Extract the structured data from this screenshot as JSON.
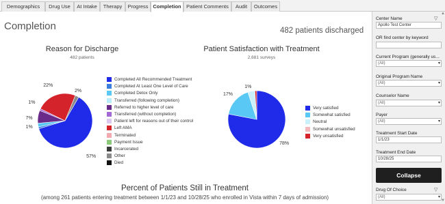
{
  "tabs": [
    {
      "label": "Demographics",
      "active": false
    },
    {
      "label": "Drug Use",
      "active": false
    },
    {
      "label": "At Intake",
      "active": false
    },
    {
      "label": "Therapy",
      "active": false
    },
    {
      "label": "Progress",
      "active": false
    },
    {
      "label": "Completion",
      "active": true
    },
    {
      "label": "Patient Comments",
      "active": false
    },
    {
      "label": "Audit",
      "active": false
    },
    {
      "label": "Outcomes",
      "active": false
    }
  ],
  "page": {
    "title": "Completion",
    "discharged": "482 patients discharged"
  },
  "chart_data": [
    {
      "type": "pie",
      "title": "Reason for Discharge",
      "subtitle": "482 patients",
      "labels": [
        "Completed All Recommended Treatment",
        "Completed At Least One Level of Care",
        "Completed Detox Only",
        "Transferred (following completion)",
        "Referred to higher level of care",
        "Transferred (without completion)",
        "Patient left for reasons out of their control",
        "Left AMA",
        "Terminated",
        "Payment Issue",
        "Incarcerated",
        "Other",
        "Died"
      ],
      "colors": [
        "#1f2be8",
        "#3a7fe0",
        "#5ac8f5",
        "#b8ecfb",
        "#6a2a8a",
        "#a36ad6",
        "#dcc7ef",
        "#d4232a",
        "#f4a8b0",
        "#8ac97a",
        "#3a3a3a",
        "#8a8a8a",
        "#111111"
      ],
      "values": [
        57,
        1,
        2,
        0,
        7,
        1,
        0,
        22,
        0,
        0,
        0,
        2,
        0
      ],
      "data_labels": [
        {
          "index": 0,
          "text": "57%"
        },
        {
          "index": 2,
          "text": "1%"
        },
        {
          "index": 4,
          "text": "7%"
        },
        {
          "index": 5,
          "text": "1%"
        },
        {
          "index": 7,
          "text": "22%"
        },
        {
          "index": 11,
          "text": "2%"
        }
      ]
    },
    {
      "type": "pie",
      "title": "Patient Satisfaction with Treatment",
      "subtitle": "2,681 surveys",
      "labels": [
        "Very satisfied",
        "Somewhat satisfied",
        "Neutral",
        "Somewhat unsatisfied",
        "Very unsatisfied"
      ],
      "colors": [
        "#1f2be8",
        "#5ac8f5",
        "#c9f0fb",
        "#f4b8bc",
        "#d4232a"
      ],
      "values": [
        78,
        17,
        4,
        0,
        1
      ],
      "data_labels": [
        {
          "index": 0,
          "text": "78%"
        },
        {
          "index": 1,
          "text": "17%"
        },
        {
          "index": 2,
          "text": "1%"
        }
      ]
    }
  ],
  "bottom": {
    "title": "Percent of Patients Still in Treatment",
    "subtitle": "(among 261 patients entering treatment between 1/1/23 and 10/28/25 who enrolled in Vista within 7 days of admission)"
  },
  "filters": {
    "center_name_label": "Center Name",
    "center_name_value": "Apollo Test Center",
    "find_center_label": "OR find center by keyword",
    "find_center_value": "",
    "current_program_label": "Current Program (generally us...",
    "current_program_value": "(All)",
    "original_program_label": "Original Program Name",
    "original_program_value": "(All)",
    "counselor_label": "Counselor Name",
    "counselor_value": "(All)",
    "payer_label": "Payer",
    "payer_value": "(All)",
    "start_date_label": "Treatment Start Date",
    "start_date_value": "1/1/23",
    "end_date_label": "Treatment End Date",
    "end_date_value": "10/28/25",
    "collapse_label": "Collapse",
    "drug_label": "Drug Of Choice",
    "drug_value": "(All)"
  }
}
